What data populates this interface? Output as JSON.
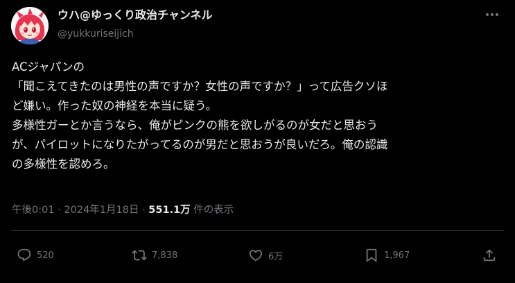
{
  "user": {
    "display_name": "ウハ@ゆっくり政治チャンネル",
    "handle": "@yukkuriseijich",
    "avatar_icon": "anime-girl-avatar-icon"
  },
  "tweet": {
    "lines": [
      "ACジャパンの",
      "「聞こえてきたのは男性の声ですか？女性の声ですか？」って広告クソほ",
      "ど嫌い。作った奴の神経を本当に疑う。",
      "多様性ガーとか言うなら、俺がピンクの熊を欲しがるのが女だと思おう",
      "が、パイロットになりたがってるのが男だと思おうが良いだろ。俺の認識",
      "の多様性を認めろ。"
    ]
  },
  "meta": {
    "time": "午後0:01",
    "sep1": " · ",
    "date": "2024年1月18日",
    "sep2": " · ",
    "views_count": "551.1万",
    "views_label": " 件の表示"
  },
  "actions": {
    "replies": "520",
    "retweets": "7,838",
    "likes": "6万",
    "bookmarks": "1,967"
  },
  "colors": {
    "background": "#000000",
    "text_primary": "#e7e9ea",
    "text_secondary": "#71767b",
    "divider": "#2f3336"
  }
}
